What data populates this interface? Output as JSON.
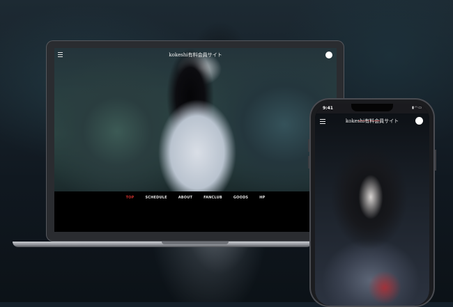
{
  "laptop": {
    "site_title": "kokeshi有料会員サイト",
    "nav": [
      {
        "label": "TOP",
        "active": true
      },
      {
        "label": "SCHEDULE",
        "active": false
      },
      {
        "label": "ABOUT",
        "active": false
      },
      {
        "label": "FANCLUB",
        "active": false
      },
      {
        "label": "GOODS",
        "active": false
      },
      {
        "label": "HP",
        "active": false
      }
    ],
    "active_color": "#d0312d"
  },
  "phone": {
    "status_time": "9:41",
    "site_title": "kokeshi有料会員サイト"
  },
  "icons": [
    "menu-icon",
    "user-avatar-icon",
    "signal-icon",
    "wifi-icon",
    "battery-icon"
  ]
}
